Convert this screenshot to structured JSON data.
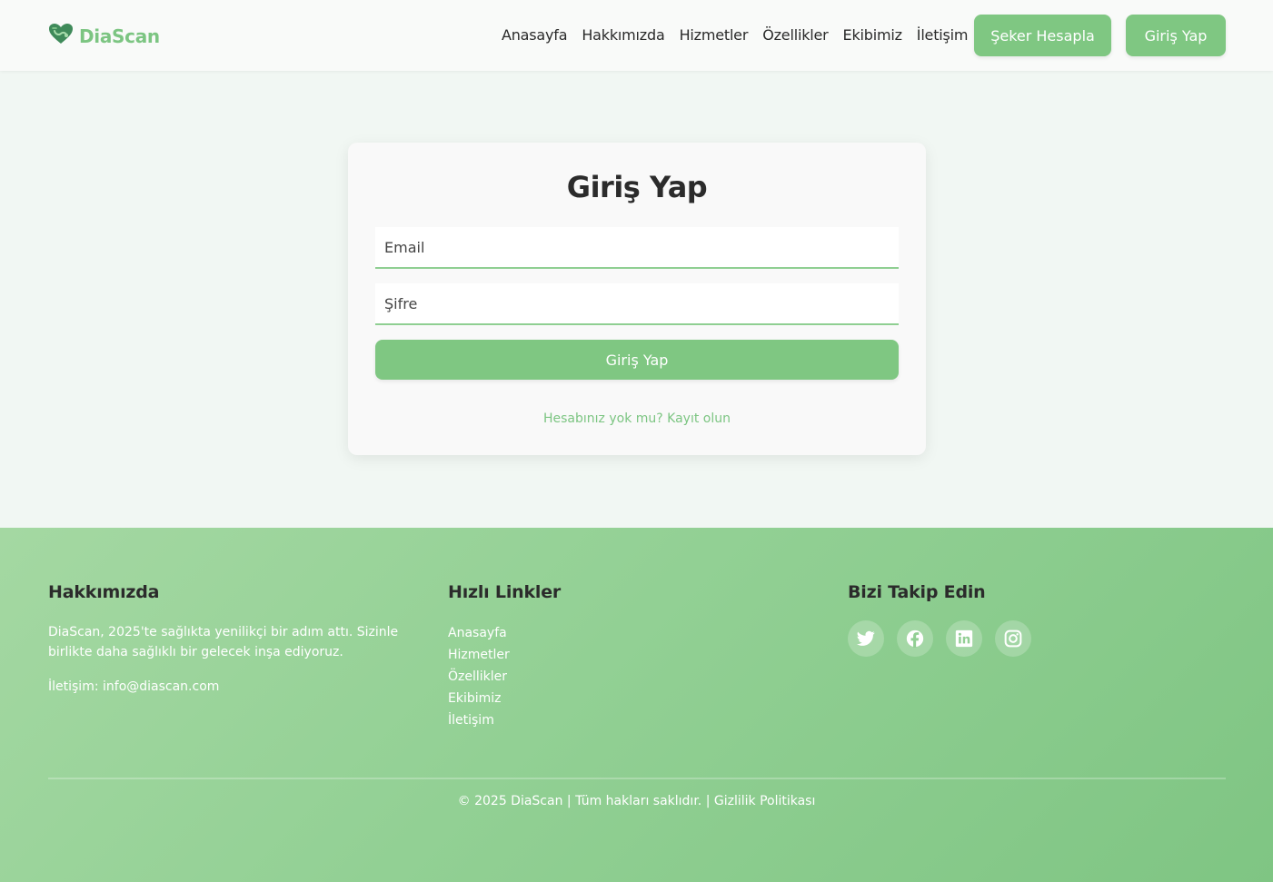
{
  "header": {
    "logo_text": "DiaScan",
    "logo_icon": "heart-stethoscope-icon",
    "nav": [
      "Anasayfa",
      "Hakkımızda",
      "Hizmetler",
      "Özellikler",
      "Ekibimiz",
      "İletişim"
    ],
    "seker_button": "Şeker Hesapla",
    "giris_button": "Giriş Yap"
  },
  "login": {
    "title": "Giriş Yap",
    "email_placeholder": "Email",
    "password_placeholder": "Şifre",
    "submit_label": "Giriş Yap",
    "register_text": "Hesabınız yok mu? Kayıt olun"
  },
  "footer": {
    "about": {
      "heading": "Hakkımızda",
      "text": "DiaScan, 2025'te sağlıkta yenilikçi bir adım attı. Sizinle birlikte daha sağlıklı bir gelecek inşa ediyoruz.",
      "contact": "İletişim: info@diascan.com"
    },
    "quick_links": {
      "heading": "Hızlı Linkler",
      "items": [
        "Anasayfa",
        "Hizmetler",
        "Özellikler",
        "Ekibimiz",
        "İletişim"
      ]
    },
    "follow": {
      "heading": "Bizi Takip Edin",
      "icons": [
        "twitter-icon",
        "facebook-icon",
        "linkedin-icon",
        "instagram-icon"
      ]
    },
    "copyright": "© 2025 DiaScan | Tüm hakları saklıdır. | Gizlilik Politikası"
  },
  "colors": {
    "accent": "#7fc782",
    "logo_dark": "#3f8a5a",
    "page_bg": "#f1f7f3"
  }
}
